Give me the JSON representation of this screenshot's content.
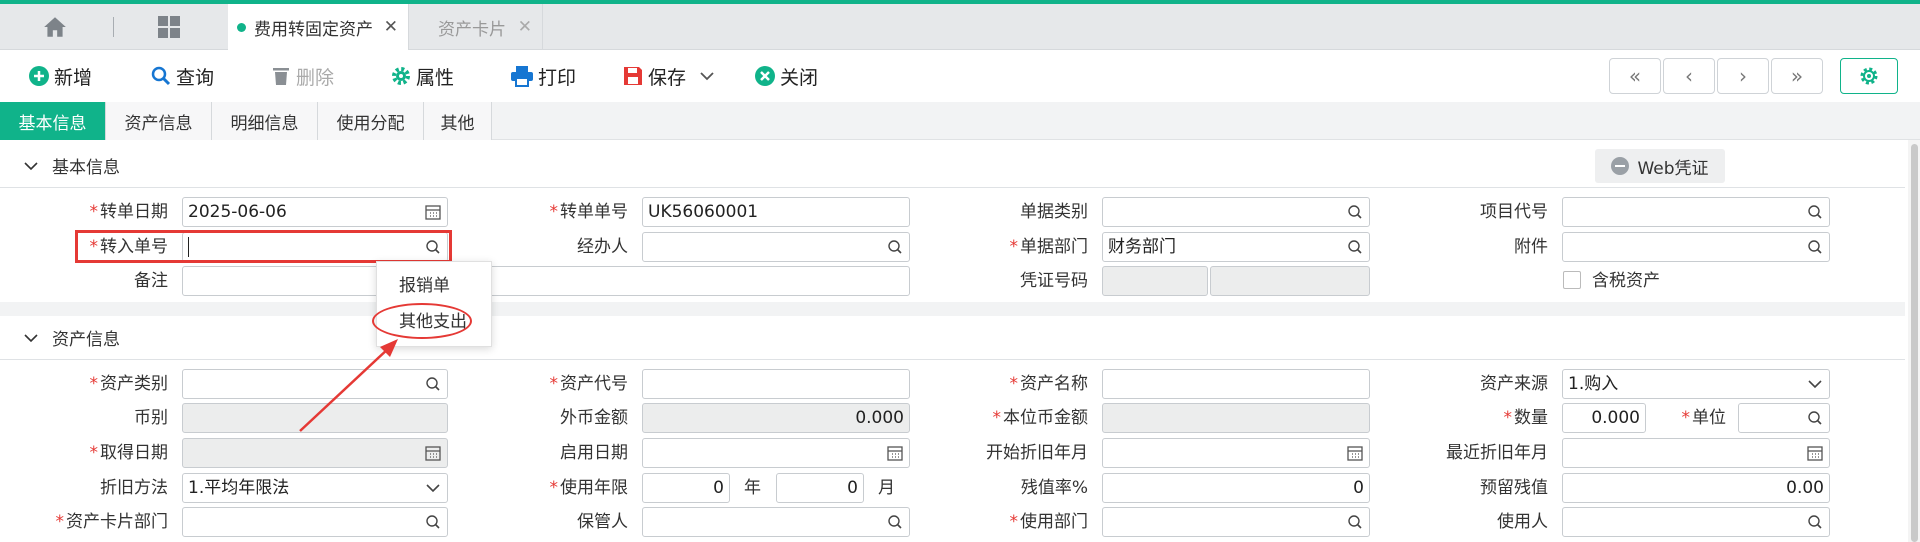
{
  "colors": {
    "accent": "#10b38a",
    "required": "#e53935",
    "highlight": "#e53935"
  },
  "tabs": [
    {
      "label": "费用转固定资产",
      "active": true
    },
    {
      "label": "资产卡片",
      "active": false
    }
  ],
  "toolbar": {
    "new": "新增",
    "query": "查询",
    "delete": "删除",
    "properties": "属性",
    "print": "打印",
    "save": "保存",
    "close": "关闭"
  },
  "subtabs": [
    "基本信息",
    "资产信息",
    "明细信息",
    "使用分配",
    "其他"
  ],
  "basic": {
    "title": "基本信息",
    "web_voucher": "Web凭证",
    "fields": {
      "transfer_date": {
        "label": "转单日期",
        "value": "2025-06-06"
      },
      "transfer_no": {
        "label": "转单单号",
        "value": "UK56060001"
      },
      "doc_type": {
        "label": "单据类别",
        "value": ""
      },
      "project_code": {
        "label": "项目代号",
        "value": ""
      },
      "in_no": {
        "label": "转入单号",
        "value": ""
      },
      "handler": {
        "label": "经办人",
        "value": ""
      },
      "doc_dept": {
        "label": "单据部门",
        "value": "财务部门"
      },
      "attachment": {
        "label": "附件",
        "value": ""
      },
      "remark": {
        "label": "备注",
        "value": ""
      },
      "voucher_no": {
        "label": "凭证号码",
        "value": ""
      },
      "tax_included": {
        "label": "含税资产"
      }
    }
  },
  "dropdown": [
    "报销单",
    "其他支出"
  ],
  "asset": {
    "title": "资产信息",
    "fields": {
      "category": {
        "label": "资产类别",
        "value": ""
      },
      "code": {
        "label": "资产代号",
        "value": ""
      },
      "name": {
        "label": "资产名称",
        "value": ""
      },
      "source": {
        "label": "资产来源",
        "value": "1.购入"
      },
      "currency": {
        "label": "币别",
        "value": ""
      },
      "foreign_amount": {
        "label": "外币金额",
        "value": "0.000"
      },
      "local_amount": {
        "label": "本位币金额",
        "value": ""
      },
      "quantity": {
        "label": "数量",
        "value": "0.000"
      },
      "unit": {
        "label": "单位",
        "value": ""
      },
      "acquire_date": {
        "label": "取得日期",
        "value": ""
      },
      "start_date": {
        "label": "启用日期",
        "value": ""
      },
      "dep_start": {
        "label": "开始折旧年月",
        "value": ""
      },
      "dep_last": {
        "label": "最近折旧年月",
        "value": ""
      },
      "dep_method": {
        "label": "折旧方法",
        "value": "1.平均年限法"
      },
      "life": {
        "label": "使用年限",
        "years": "0",
        "year_unit": "年",
        "months": "0",
        "month_unit": "月"
      },
      "residual_rate": {
        "label": "残值率%",
        "value": "0"
      },
      "reserved_residual": {
        "label": "预留残值",
        "value": "0.00"
      },
      "card_dept": {
        "label": "资产卡片部门",
        "value": ""
      },
      "keeper": {
        "label": "保管人",
        "value": ""
      },
      "use_dept": {
        "label": "使用部门",
        "value": ""
      },
      "user": {
        "label": "使用人",
        "value": ""
      }
    }
  }
}
